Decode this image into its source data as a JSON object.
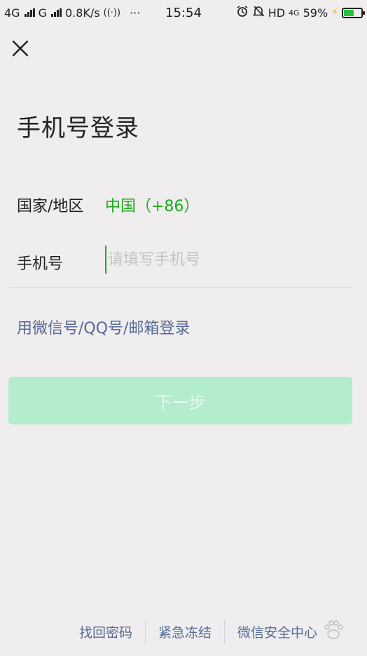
{
  "status_bar": {
    "left_text_1": "4G",
    "left_text_2": "G",
    "speed": "0.8K/s",
    "more": "···",
    "time": "15:54",
    "hd": "HD",
    "net_4g": "4G",
    "battery_percent": "59%",
    "battery_level": 0.59,
    "battery_color": "#23c33c"
  },
  "header": {
    "title": "手机号登录"
  },
  "form": {
    "country_label": "国家/地区",
    "country_value": "中国（+86）",
    "phone_label": "手机号",
    "phone_placeholder": "请填写手机号",
    "phone_value": ""
  },
  "alt_login": {
    "label": "用微信号/QQ号/邮箱登录"
  },
  "next_button": {
    "label": "下一步"
  },
  "footer": {
    "links": [
      "找回密码",
      "紧急冻结",
      "微信安全中心"
    ]
  },
  "colors": {
    "accent_green": "#1aad19",
    "link_blue": "#576b95",
    "button_disabled_bg": "#b3edcc"
  }
}
